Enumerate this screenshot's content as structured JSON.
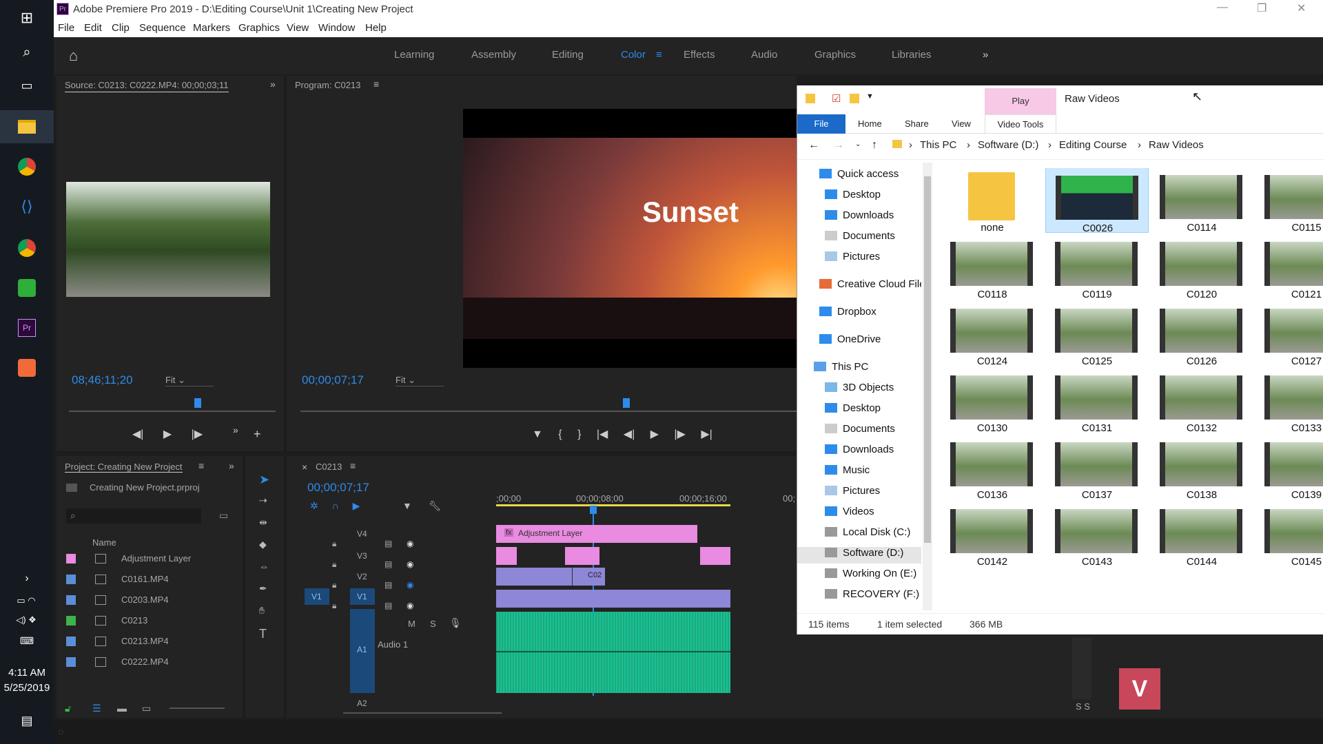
{
  "taskbar": {
    "time": "4:11 AM",
    "date": "5/25/2019"
  },
  "app": {
    "title": "Adobe Premiere Pro 2019 - D:\\Editing Course\\Unit 1\\Creating New Project"
  },
  "menu": [
    "File",
    "Edit",
    "Clip",
    "Sequence",
    "Markers",
    "Graphics",
    "View",
    "Window",
    "Help"
  ],
  "workspaces": [
    "Learning",
    "Assembly",
    "Editing",
    "Color",
    "Effects",
    "Audio",
    "Graphics",
    "Libraries"
  ],
  "active_workspace": "Color",
  "source": {
    "title": "Source: C0213: C0222.MP4: 00;00;03;11",
    "timecode": "08;46;11;20",
    "fit": "Fit"
  },
  "program": {
    "title": "Program: C0213",
    "overlay_text": "Sunset",
    "timecode": "00;00;07;17",
    "fit": "Fit"
  },
  "project": {
    "title": "Project: Creating New Project",
    "file": "Creating New Project.prproj",
    "column": "Name",
    "items": [
      {
        "name": "Adjustment Layer",
        "color": "#e98be0"
      },
      {
        "name": "C0161.MP4",
        "color": "#5a8fd8"
      },
      {
        "name": "C0203.MP4",
        "color": "#5a8fd8"
      },
      {
        "name": "C0213",
        "color": "#3cb34b"
      },
      {
        "name": "C0213.MP4",
        "color": "#5a8fd8"
      },
      {
        "name": "C0222.MP4",
        "color": "#5a8fd8"
      }
    ]
  },
  "timeline": {
    "tab": "C0213",
    "timecode": "00;00;07;17",
    "ruler": [
      ";00;00",
      "00;00;08;00",
      "00;00;16;00",
      "00;"
    ],
    "tracks": [
      "V4",
      "V3",
      "V2",
      "V1",
      "A1",
      "A2"
    ],
    "src_v1": "V1",
    "adjustment_label": "Adjustment Layer",
    "clip_v2": "C02",
    "audio_label": "Audio 1",
    "mute": "M",
    "solo": "S",
    "fx": "fx"
  },
  "explorer": {
    "ribbon_context": "Play",
    "title": "Raw Videos",
    "tabs": [
      "File",
      "Home",
      "Share",
      "View",
      "Video Tools"
    ],
    "breadcrumb": [
      "This PC",
      "Software (D:)",
      "Editing Course",
      "Raw Videos"
    ],
    "nav": [
      "Quick access",
      "Desktop",
      "Downloads",
      "Documents",
      "Pictures",
      "Creative Cloud File",
      "Dropbox",
      "OneDrive",
      "This PC",
      "3D Objects",
      "Desktop",
      "Documents",
      "Downloads",
      "Music",
      "Pictures",
      "Videos",
      "Local Disk (C:)",
      "Software (D:)",
      "Working On (E:)",
      "RECOVERY (F:)"
    ],
    "files": [
      "none",
      "C0026",
      "C0114",
      "C0115",
      "C0118",
      "C0119",
      "C0120",
      "C0121",
      "C0124",
      "C0125",
      "C0126",
      "C0127",
      "C0130",
      "C0131",
      "C0132",
      "C0133",
      "C0136",
      "C0137",
      "C0138",
      "C0139",
      "C0142",
      "C0143",
      "C0144",
      "C0145"
    ],
    "selected": "C0026",
    "status": {
      "count": "115 items",
      "selection": "1 item selected",
      "size": "366 MB"
    }
  },
  "meters": {
    "s1": "S",
    "s2": "S"
  }
}
